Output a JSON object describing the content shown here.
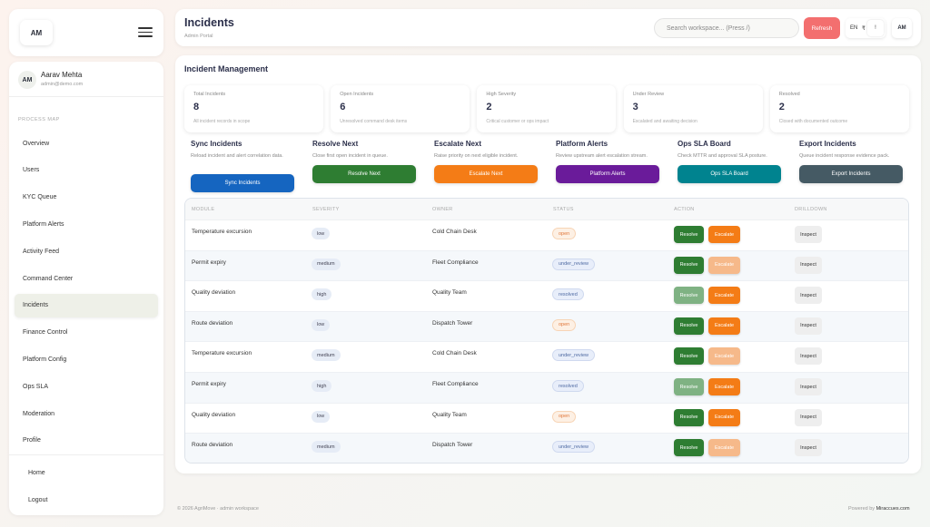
{
  "brand": {
    "logo_text": "AM"
  },
  "user": {
    "initials": "AM",
    "name": "Aarav Mehta",
    "email": "admin@demo.com"
  },
  "sidebar": {
    "section_title": "PROCESS MAP",
    "items": [
      {
        "label": "Overview",
        "active": false
      },
      {
        "label": "Users",
        "active": false
      },
      {
        "label": "KYC Queue",
        "active": false
      },
      {
        "label": "Platform Alerts",
        "active": false
      },
      {
        "label": "Activity Feed",
        "active": false
      },
      {
        "label": "Command Center",
        "active": false
      },
      {
        "label": "Incidents",
        "active": true
      },
      {
        "label": "Finance Control",
        "active": false
      },
      {
        "label": "Platform Config",
        "active": false
      },
      {
        "label": "Ops SLA",
        "active": false
      },
      {
        "label": "Moderation",
        "active": false
      },
      {
        "label": "Profile",
        "active": false
      }
    ],
    "bottom_items": [
      {
        "label": "Home"
      },
      {
        "label": "Logout"
      }
    ]
  },
  "header": {
    "title": "Incidents",
    "subtitle": "Admin Portal",
    "search_placeholder": "Search workspace... (Press /)",
    "refresh_label": "Refresh",
    "lang": "EN",
    "currency": "₹",
    "info": "!",
    "avatar": "AM"
  },
  "main": {
    "title": "Incident Management",
    "stats": [
      {
        "label": "Total Incidents",
        "value": "8",
        "desc": "All incident records in scope"
      },
      {
        "label": "Open Incidents",
        "value": "6",
        "desc": "Unresolved command desk items"
      },
      {
        "label": "High Severity",
        "value": "2",
        "desc": "Critical customer or ops impact"
      },
      {
        "label": "Under Review",
        "value": "3",
        "desc": "Escalated and awaiting decision"
      },
      {
        "label": "Resolved",
        "value": "2",
        "desc": "Closed with documented outcome"
      }
    ],
    "actions": [
      {
        "title": "Sync Incidents",
        "desc": "Reload incident and alert correlation data.",
        "button": "Sync Incidents",
        "color": "#1565c0"
      },
      {
        "title": "Resolve Next",
        "desc": "Close first open incident in queue.",
        "button": "Resolve Next",
        "color": "#2e7d32"
      },
      {
        "title": "Escalate Next",
        "desc": "Raise priority on next eligible incident.",
        "button": "Escalate Next",
        "color": "#f47c16"
      },
      {
        "title": "Platform Alerts",
        "desc": "Review upstream alert escalation stream.",
        "button": "Platform Alerts",
        "color": "#6a1b9a"
      },
      {
        "title": "Ops SLA Board",
        "desc": "Check MTTR and approval SLA posture.",
        "button": "Ops SLA Board",
        "color": "#00838f"
      },
      {
        "title": "Export Incidents",
        "desc": "Queue incident response evidence pack.",
        "button": "Export Incidents",
        "color": "#455a64"
      }
    ],
    "table": {
      "headers": [
        "MODULE",
        "SEVERITY",
        "OWNER",
        "STATUS",
        "ACTION",
        "DRILLDOWN"
      ],
      "resolve_label": "Resolve",
      "escalate_label": "Escalate",
      "inspect_label": "Inspect",
      "rows": [
        {
          "module": "Temperature excursion",
          "severity": "low",
          "owner": "Cold Chain Desk",
          "status": "open",
          "resolve_enabled": true,
          "escalate_enabled": true
        },
        {
          "module": "Permit expiry",
          "severity": "medium",
          "owner": "Fleet Compliance",
          "status": "under_review",
          "resolve_enabled": true,
          "escalate_enabled": false
        },
        {
          "module": "Quality deviation",
          "severity": "high",
          "owner": "Quality Team",
          "status": "resolved",
          "resolve_enabled": false,
          "escalate_enabled": true
        },
        {
          "module": "Route deviation",
          "severity": "low",
          "owner": "Dispatch Tower",
          "status": "open",
          "resolve_enabled": true,
          "escalate_enabled": true
        },
        {
          "module": "Temperature excursion",
          "severity": "medium",
          "owner": "Cold Chain Desk",
          "status": "under_review",
          "resolve_enabled": true,
          "escalate_enabled": false
        },
        {
          "module": "Permit expiry",
          "severity": "high",
          "owner": "Fleet Compliance",
          "status": "resolved",
          "resolve_enabled": false,
          "escalate_enabled": true
        },
        {
          "module": "Quality deviation",
          "severity": "low",
          "owner": "Quality Team",
          "status": "open",
          "resolve_enabled": true,
          "escalate_enabled": true
        },
        {
          "module": "Route deviation",
          "severity": "medium",
          "owner": "Dispatch Tower",
          "status": "under_review",
          "resolve_enabled": true,
          "escalate_enabled": false
        }
      ]
    }
  },
  "footer": {
    "left": "© 2026 AgriMove · admin workspace",
    "right_prefix": "Powered by",
    "right_brand": "Miraccues.com"
  }
}
